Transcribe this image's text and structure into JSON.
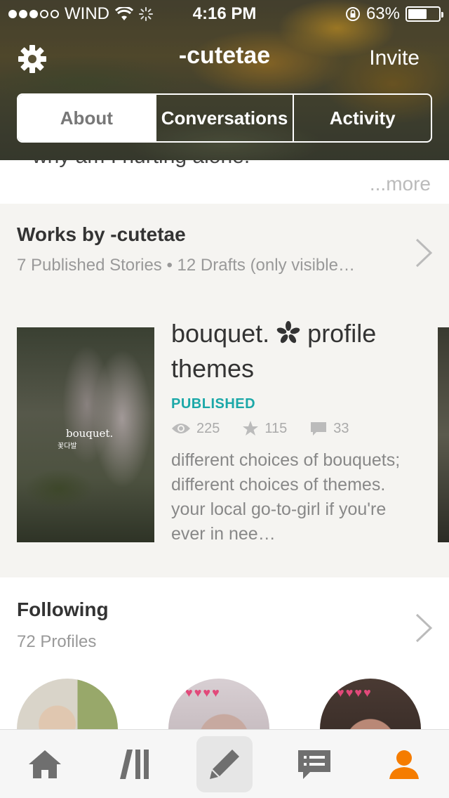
{
  "status_bar": {
    "carrier": "WIND",
    "time": "4:16 PM",
    "battery_text": "63%",
    "battery_level": 0.63
  },
  "nav": {
    "title": "-cutetae",
    "invite_label": "Invite"
  },
  "tabs": [
    {
      "label": "About",
      "active": true
    },
    {
      "label": "Conversations",
      "active": false
    },
    {
      "label": "Activity",
      "active": false
    }
  ],
  "about": {
    "partial_text": "why am I hurting alone.",
    "more_label": "...more"
  },
  "works": {
    "title": "Works by -cutetae",
    "subtitle": "7 Published Stories • 12 Drafts (only visible…",
    "story": {
      "cover_title": "bouquet.",
      "cover_subtitle": "꽃다발",
      "title_part1": "bouquet.",
      "title_part2": "profile themes",
      "status": "PUBLISHED",
      "reads": "225",
      "votes": "115",
      "comments": "33",
      "description": "different choices of bouquets; different choices of themes. your local go-to-girl if you're ever     in nee…"
    }
  },
  "following": {
    "title": "Following",
    "subtitle": "72 Profiles"
  },
  "colors": {
    "accent_teal": "#1ba8a8",
    "accent_orange": "#f57c00",
    "icon_gray": "#6f6f6f"
  },
  "tabbar": {
    "items": [
      "home-icon",
      "library-icon",
      "write-icon",
      "messages-icon",
      "profile-icon"
    ],
    "active": "profile-icon"
  }
}
